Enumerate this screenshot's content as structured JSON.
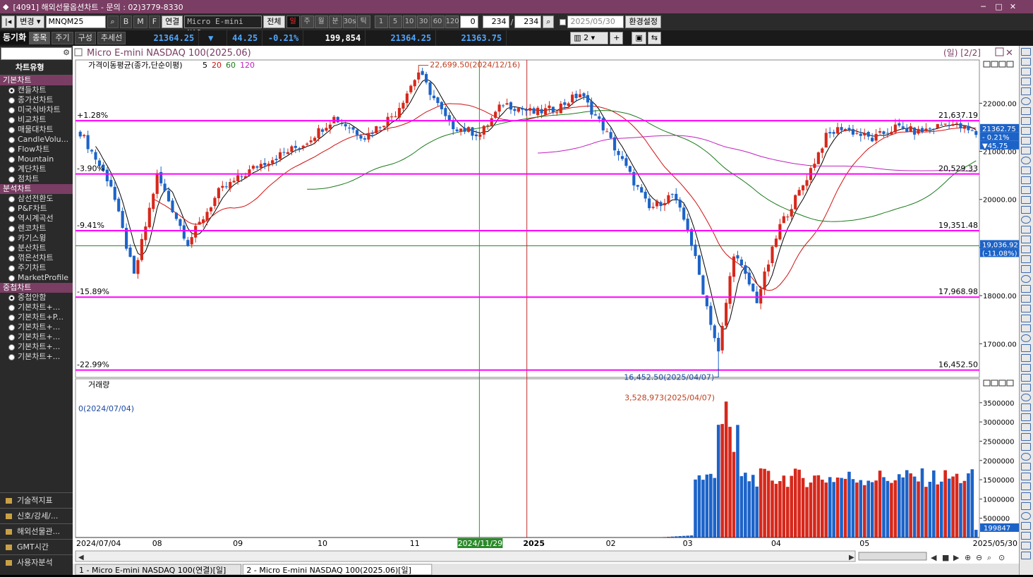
{
  "window": {
    "title": "[4091] 해외선물옵션차트 - 문의 : 02)3779-8330"
  },
  "toolbar1": {
    "change_label": "변경",
    "code": "MNQM25",
    "b_label": "B",
    "m_label": "M",
    "f_label": "F",
    "link_label": "연결",
    "instrument": "Micro E-mini NAS",
    "all_label": "전체",
    "periods": [
      "일",
      "주",
      "월",
      "분",
      "30s",
      "틱"
    ],
    "intervals": [
      "1",
      "5",
      "10",
      "30",
      "60",
      "120"
    ],
    "num_input": "0",
    "count_a": "234",
    "count_b": "234",
    "date_value": "2025/05/30",
    "settings_label": "환경설정"
  },
  "toolbar2": {
    "sync_label": "동기화",
    "tabs": [
      "종목",
      "주기",
      "구성",
      "추세선"
    ],
    "price": "21364.25",
    "change_arrow": "▼",
    "change": "44.25",
    "change_pct": "-0.21%",
    "volume": "199,854",
    "bid": "21364.25",
    "ask": "21363.75",
    "layout_num": "2"
  },
  "sidebar": {
    "chart_type_header": "차트유형",
    "basic_header": "기본차트",
    "basic_items": [
      {
        "label": "캔들차트",
        "selected": true
      },
      {
        "label": "종가선차트"
      },
      {
        "label": "미국식바차트"
      },
      {
        "label": "비교차트"
      },
      {
        "label": "매물대차트"
      },
      {
        "label": "CandleVolu..."
      },
      {
        "label": "Flow차트"
      },
      {
        "label": "Mountain"
      },
      {
        "label": "계단차트"
      },
      {
        "label": "점차트"
      }
    ],
    "analysis_header": "분석차트",
    "analysis_items": [
      {
        "label": "삼선전환도"
      },
      {
        "label": "P&F차트"
      },
      {
        "label": "역시계곡선"
      },
      {
        "label": "렌코차트"
      },
      {
        "label": "카기스윙"
      },
      {
        "label": "분산차트"
      },
      {
        "label": "꺾은선차트"
      },
      {
        "label": "주기차트"
      },
      {
        "label": "MarketProfile"
      }
    ],
    "overlay_header": "중첩차트",
    "overlay_items": [
      {
        "label": "중첩안함",
        "selected": true
      },
      {
        "label": "기본차트+..."
      },
      {
        "label": "기본차트+P..."
      },
      {
        "label": "기본차트+..."
      },
      {
        "label": "기본차트+..."
      },
      {
        "label": "기본차트+..."
      },
      {
        "label": "기본차트+..."
      }
    ],
    "bottom_sections": [
      "기술적지표",
      "신호/강세/...",
      "해외선물관...",
      "GMT시간",
      "사용자분석"
    ]
  },
  "chart": {
    "title": "Micro E-mini NASDAQ 100(2025.06)",
    "period_tag": "(일) [2/2]",
    "ma_label": "가격이동평균(종가,단순이평)",
    "ma_periods": [
      "5",
      "20",
      "60",
      "120"
    ],
    "volume_label": "거래량",
    "price_levels": [
      {
        "pct": "+1.28%",
        "value": "21,637.19"
      },
      {
        "pct": "-3.90%",
        "value": "20,529.33"
      },
      {
        "pct": "-9.41%",
        "value": "19,351.48"
      },
      {
        "pct": "-15.89%",
        "value": "17,968.98"
      },
      {
        "pct": "-22.99%",
        "value": "16,452.50"
      }
    ],
    "high_annotation": "22,699.50(2024/12/16)",
    "low_annotation": "16,452.50(2025/04/07)",
    "vol_annotation": "3,528,973(2025/04/07)",
    "vol_min_annotation": "0(2024/07/04)",
    "price_ticks": [
      "22000.00",
      "21000.00",
      "20000.00",
      "19000.00",
      "18000.00",
      "17000.00"
    ],
    "vol_ticks": [
      "3500000",
      "3000000",
      "2500000",
      "2000000",
      "1500000",
      "1000000",
      "500000"
    ],
    "last_price_box": [
      "21362.75",
      "- 0.21%",
      "▼45.75"
    ],
    "cursor_box": [
      "19,036.92",
      "(-11.08%)"
    ],
    "vol_last_box": "199847",
    "x_labels": [
      "2024/07/04",
      "08",
      "09",
      "10",
      "11",
      "2024/11/29",
      "2025",
      "02",
      "03",
      "04",
      "05",
      "2025/05/30"
    ],
    "tabs": [
      "1 - Micro E-mini NASDAQ 100(연결)[일]",
      "2 - Micro E-mini NASDAQ 100(2025.06)[일]"
    ],
    "ohlc_anchors": [
      [
        0,
        21400
      ],
      [
        8,
        20300
      ],
      [
        14,
        18400
      ],
      [
        20,
        20500
      ],
      [
        28,
        19100
      ],
      [
        36,
        20150
      ],
      [
        46,
        20700
      ],
      [
        58,
        21150
      ],
      [
        66,
        21700
      ],
      [
        74,
        21300
      ],
      [
        82,
        21800
      ],
      [
        88,
        22650
      ],
      [
        96,
        21550
      ],
      [
        104,
        21350
      ],
      [
        110,
        22000
      ],
      [
        118,
        21800
      ],
      [
        124,
        21900
      ],
      [
        130,
        22200
      ],
      [
        136,
        21500
      ],
      [
        142,
        20650
      ],
      [
        148,
        19800
      ],
      [
        154,
        20100
      ],
      [
        158,
        19400
      ],
      [
        162,
        18100
      ],
      [
        166,
        16800
      ],
      [
        170,
        18900
      ],
      [
        176,
        17900
      ],
      [
        182,
        19450
      ],
      [
        188,
        20300
      ],
      [
        194,
        21300
      ],
      [
        198,
        21500
      ],
      [
        206,
        21250
      ],
      [
        212,
        21500
      ],
      [
        218,
        21400
      ],
      [
        226,
        21600
      ],
      [
        233,
        21360
      ]
    ]
  },
  "colors": {
    "accent": "#7a3d63",
    "up": "#d6281b",
    "down": "#1c63c8",
    "level": "#ff00ff",
    "ma5": "#000000",
    "ma20": "#d01010",
    "ma60": "#1c7a1c",
    "ma120": "#c020c0"
  }
}
